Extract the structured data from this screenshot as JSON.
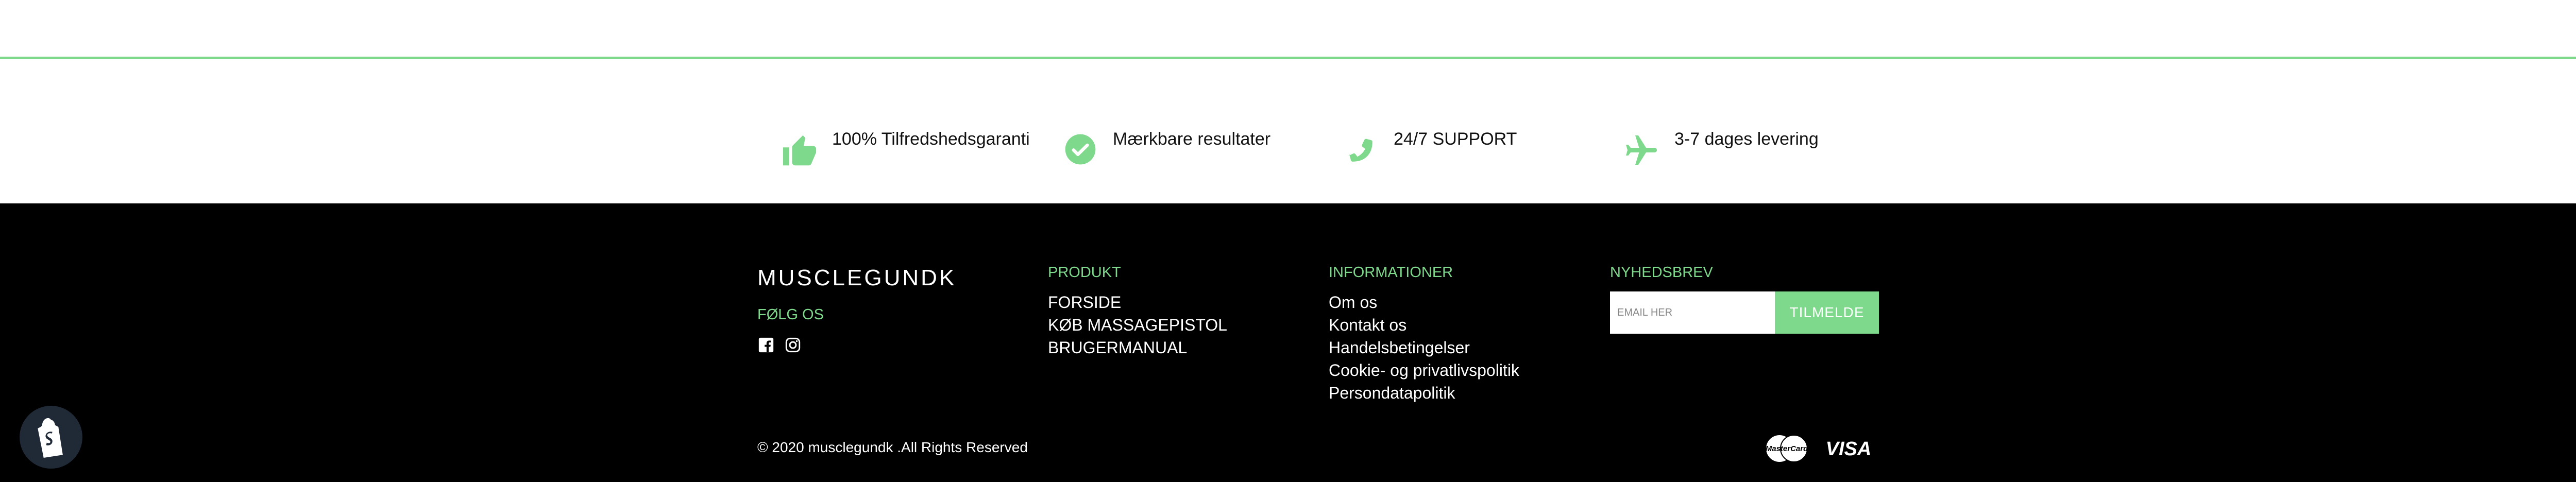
{
  "features": [
    {
      "icon": "thumbs-up-icon",
      "label": "100% Tilfredshedsgaranti"
    },
    {
      "icon": "check-circle-icon",
      "label": "Mærkbare resultater"
    },
    {
      "icon": "phone-icon",
      "label": "24/7 SUPPORT"
    },
    {
      "icon": "airplane-icon",
      "label": "3-7 dages levering"
    }
  ],
  "footer": {
    "brand": "MUSCLEGUNDK",
    "follow_label": "FØLG OS",
    "social": [
      "facebook-icon",
      "instagram-icon"
    ],
    "produkt": {
      "title": "PRODUKT",
      "items": [
        "FORSIDE",
        "KØB MASSAGEPISTOL",
        "BRUGERMANUAL"
      ]
    },
    "info": {
      "title": "INFORMATIONER",
      "items": [
        "Om os",
        "Kontakt os",
        "Handelsbetingelser",
        "Cookie- og privatlivspolitik",
        "Persondatapolitik"
      ]
    },
    "newsletter": {
      "title": "NYHEDSBREV",
      "placeholder": "EMAIL HER",
      "button": "TILMELDE"
    },
    "copyright": "© 2020 musclegundk .All Rights Reserved",
    "payments": [
      "mastercard-icon",
      "visa-icon"
    ]
  },
  "colors": {
    "accent": "#7ed98c",
    "footer_bg": "#000000"
  }
}
